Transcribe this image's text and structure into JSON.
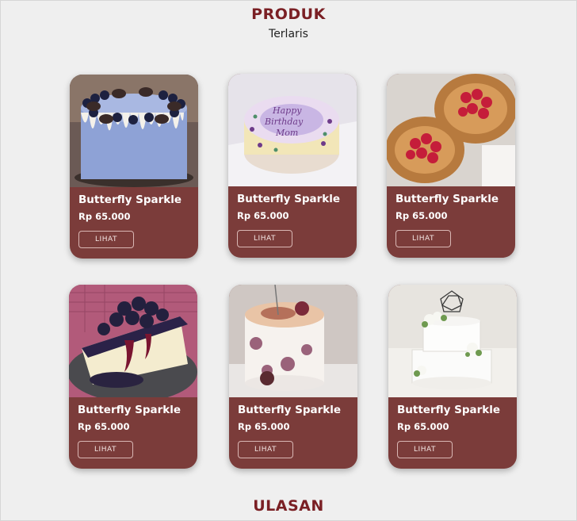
{
  "section": {
    "title": "PRODUK",
    "subtitle": "Terlaris"
  },
  "products": [
    {
      "name": "Butterfly Sparkle",
      "price": "Rp 65.000",
      "button": "LIHAT",
      "image": "blueberry-drip-cake"
    },
    {
      "name": "Butterfly Sparkle",
      "price": "Rp 65.000",
      "button": "LIHAT",
      "image": "happy-birthday-mom-cake"
    },
    {
      "name": "Butterfly Sparkle",
      "price": "Rp 65.000",
      "button": "LIHAT",
      "image": "raspberry-danish-pastry"
    },
    {
      "name": "Butterfly Sparkle",
      "price": "Rp 65.000",
      "button": "LIHAT",
      "image": "blueberry-cheesecake-slice"
    },
    {
      "name": "Butterfly Sparkle",
      "price": "Rp 65.000",
      "button": "LIHAT",
      "image": "floral-mini-cake"
    },
    {
      "name": "Butterfly Sparkle",
      "price": "Rp 65.000",
      "button": "LIHAT",
      "image": "white-wedding-cake"
    }
  ],
  "next_section": {
    "title": "ULASAN"
  },
  "colors": {
    "accent": "#7a1f24",
    "card": "#7b3c3a",
    "background": "#efefef"
  }
}
